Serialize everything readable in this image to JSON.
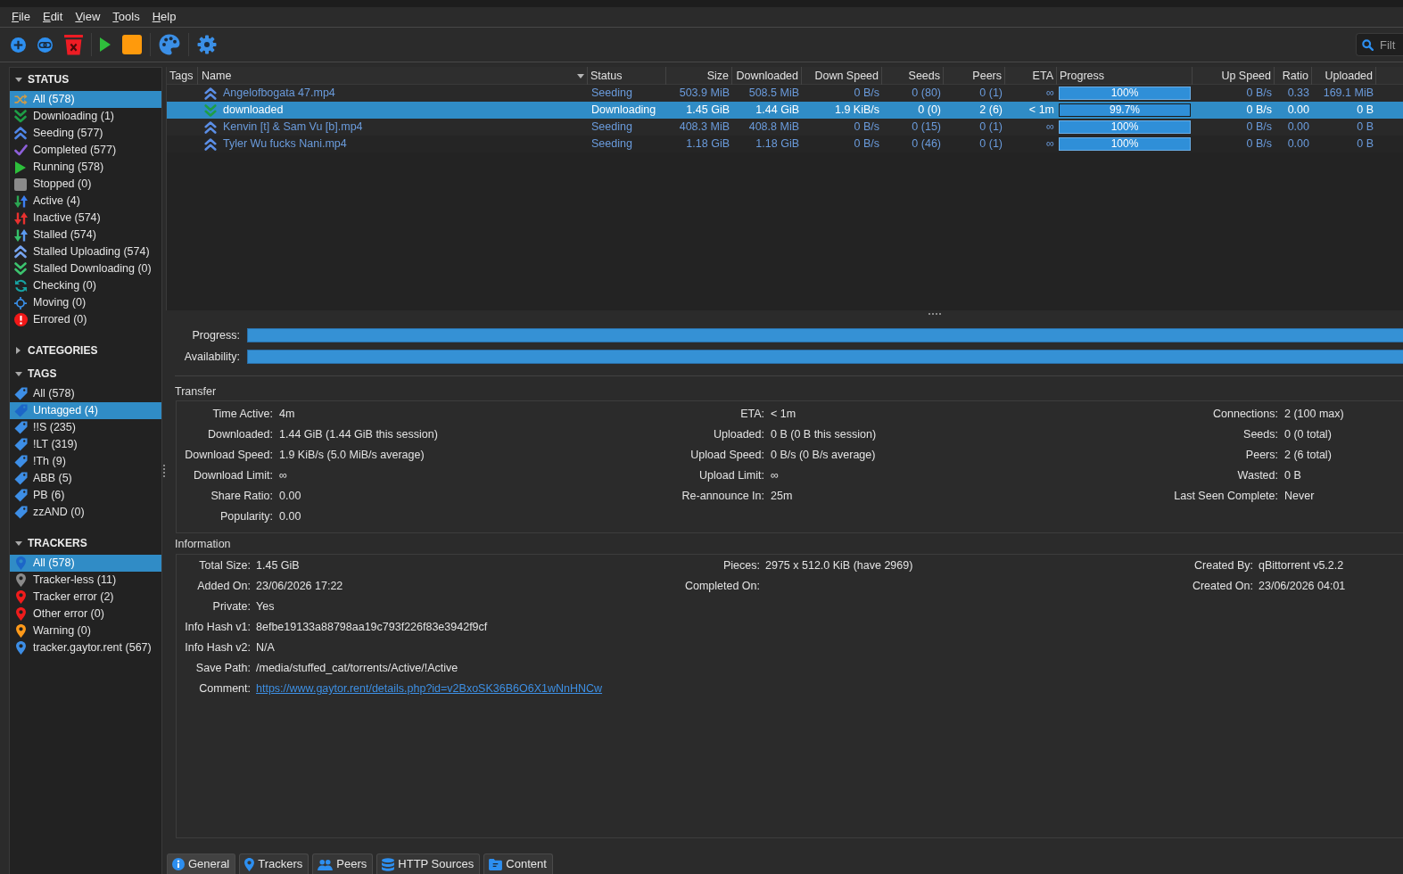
{
  "menu": [
    "File",
    "Edit",
    "View",
    "Tools",
    "Help"
  ],
  "toolbar": {
    "search": {
      "placeholder": "Filt"
    }
  },
  "sidebar": {
    "sections": [
      {
        "title": "STATUS",
        "expanded": true,
        "items": [
          {
            "label": "All (578)",
            "kind": "all",
            "selected": true
          },
          {
            "label": "Downloading (1)",
            "kind": "downloading",
            "selected": false
          },
          {
            "label": "Seeding (577)",
            "kind": "seeding",
            "selected": false
          },
          {
            "label": "Completed (577)",
            "kind": "completed",
            "selected": false
          },
          {
            "label": "Running (578)",
            "kind": "running",
            "selected": false
          },
          {
            "label": "Stopped (0)",
            "kind": "stopped",
            "selected": false
          },
          {
            "label": "Active (4)",
            "kind": "active",
            "selected": false
          },
          {
            "label": "Inactive (574)",
            "kind": "inactive",
            "selected": false
          },
          {
            "label": "Stalled (574)",
            "kind": "stalled",
            "selected": false
          },
          {
            "label": "Stalled Uploading (574)",
            "kind": "stalledup",
            "selected": false
          },
          {
            "label": "Stalled Downloading (0)",
            "kind": "stalleddown",
            "selected": false
          },
          {
            "label": "Checking (0)",
            "kind": "checking",
            "selected": false
          },
          {
            "label": "Moving (0)",
            "kind": "moving",
            "selected": false
          },
          {
            "label": "Errored (0)",
            "kind": "errored",
            "selected": false
          }
        ]
      },
      {
        "title": "CATEGORIES",
        "expanded": false
      },
      {
        "title": "TAGS",
        "expanded": true,
        "items": [
          {
            "label": "All (578)",
            "kind": "tag",
            "selected": false
          },
          {
            "label": "Untagged (4)",
            "kind": "tag",
            "selected": true
          },
          {
            "label": "!!S (235)",
            "kind": "tag",
            "selected": false
          },
          {
            "label": "!LT (319)",
            "kind": "tag",
            "selected": false
          },
          {
            "label": "!Th (9)",
            "kind": "tag",
            "selected": false
          },
          {
            "label": "ABB (5)",
            "kind": "tag",
            "selected": false
          },
          {
            "label": "PB (6)",
            "kind": "tag",
            "selected": false
          },
          {
            "label": "zzAND (0)",
            "kind": "tag",
            "selected": false
          }
        ]
      },
      {
        "title": "TRACKERS",
        "expanded": true,
        "items": [
          {
            "label": "All (578)",
            "kind": "pin",
            "color": "#1c66c8",
            "selected": true
          },
          {
            "label": "Tracker-less (11)",
            "kind": "pin",
            "color": "#8a8a8a",
            "selected": false
          },
          {
            "label": "Tracker error (2)",
            "kind": "pin",
            "color": "#f01c1c",
            "selected": false
          },
          {
            "label": "Other error (0)",
            "kind": "pin",
            "color": "#f01c1c",
            "selected": false
          },
          {
            "label": "Warning (0)",
            "kind": "pin",
            "color": "#ff9a1a",
            "selected": false
          },
          {
            "label": "tracker.gaytor.rent (567)",
            "kind": "pin",
            "color": "#3d8ee6",
            "selected": false
          }
        ]
      }
    ]
  },
  "table": {
    "columns": [
      {
        "label": "Tags",
        "sorted": false
      },
      {
        "label": "Name",
        "sorted": true
      },
      {
        "label": "Status",
        "sorted": false
      },
      {
        "label": "Size",
        "sorted": false
      },
      {
        "label": "Downloaded",
        "sorted": false
      },
      {
        "label": "Down Speed",
        "sorted": false
      },
      {
        "label": "Seeds",
        "sorted": false
      },
      {
        "label": "Peers",
        "sorted": false
      },
      {
        "label": "ETA",
        "sorted": false
      },
      {
        "label": "Progress",
        "sorted": false
      },
      {
        "label": "Up Speed",
        "sorted": false
      },
      {
        "label": "Ratio",
        "sorted": false
      },
      {
        "label": "Uploaded",
        "sorted": false
      }
    ],
    "rows": [
      {
        "kind": "seeding",
        "selected": false,
        "name": "Angelofbogata 47.mp4",
        "status": "Seeding",
        "size": "503.9 MiB",
        "downloaded": "508.5 MiB",
        "down_speed": "0 B/s",
        "seeds": "0 (80)",
        "peers": "0 (1)",
        "eta": "∞",
        "progress": {
          "level": 1,
          "text": "100%"
        },
        "up_speed": "0 B/s",
        "ratio": "0.33",
        "uploaded": "169.1 MiB"
      },
      {
        "kind": "downloading",
        "selected": true,
        "name": "downloaded",
        "status": "Downloading",
        "size": "1.45 GiB",
        "downloaded": "1.44 GiB",
        "down_speed": "1.9 KiB/s",
        "seeds": "0 (0)",
        "peers": "2 (6)",
        "eta": "< 1m",
        "progress": {
          "level": 0.997,
          "text": "99.7%"
        },
        "up_speed": "0 B/s",
        "ratio": "0.00",
        "uploaded": "0 B"
      },
      {
        "kind": "seeding",
        "selected": false,
        "name": "Kenvin [t] & Sam Vu [b].mp4",
        "status": "Seeding",
        "size": "408.3 MiB",
        "downloaded": "408.8 MiB",
        "down_speed": "0 B/s",
        "seeds": "0 (15)",
        "peers": "0 (1)",
        "eta": "∞",
        "progress": {
          "level": 1,
          "text": "100%"
        },
        "up_speed": "0 B/s",
        "ratio": "0.00",
        "uploaded": "0 B"
      },
      {
        "kind": "seeding",
        "selected": false,
        "name": "Tyler Wu fucks Nani.mp4",
        "status": "Seeding",
        "size": "1.18 GiB",
        "downloaded": "1.18 GiB",
        "down_speed": "0 B/s",
        "seeds": "0 (46)",
        "peers": "0 (1)",
        "eta": "∞",
        "progress": {
          "level": 1,
          "text": "100%"
        },
        "up_speed": "0 B/s",
        "ratio": "0.00",
        "uploaded": "0 B"
      }
    ]
  },
  "details": {
    "bars": [
      {
        "label": "Progress:",
        "level": 1
      },
      {
        "label": "Availability:",
        "level": 1
      }
    ],
    "groups": [
      {
        "title": "Transfer",
        "rows": [
          [
            {
              "label": "Time Active:",
              "value": "4m"
            },
            {
              "label": "ETA:",
              "value": "< 1m"
            },
            {
              "label": "Connections:",
              "value": "2 (100 max)"
            }
          ],
          [
            {
              "label": "Downloaded:",
              "value": "1.44 GiB (1.44 GiB this session)"
            },
            {
              "label": "Uploaded:",
              "value": "0 B (0 B this session)"
            },
            {
              "label": "Seeds:",
              "value": "0 (0 total)"
            }
          ],
          [
            {
              "label": "Download Speed:",
              "value": "1.9 KiB/s (5.0 MiB/s average)"
            },
            {
              "label": "Upload Speed:",
              "value": "0 B/s (0 B/s average)"
            },
            {
              "label": "Peers:",
              "value": "2 (6 total)"
            }
          ],
          [
            {
              "label": "Download Limit:",
              "value": "∞"
            },
            {
              "label": "Upload Limit:",
              "value": "∞"
            },
            {
              "label": "Wasted:",
              "value": "0 B"
            }
          ],
          [
            {
              "label": "Share Ratio:",
              "value": "0.00"
            },
            {
              "label": "Re-announce In:",
              "value": "25m"
            },
            {
              "label": "Last Seen Complete:",
              "value": "Never"
            }
          ],
          [
            {
              "label": "Popularity:",
              "value": "0.00"
            }
          ]
        ]
      },
      {
        "title": "Information",
        "rows": [
          [
            {
              "label": "Total Size:",
              "value": "1.45 GiB"
            },
            {
              "label": "Pieces:",
              "value": "2975 x 512.0 KiB (have 2969)"
            },
            {
              "label": "Created By:",
              "value": "qBittorrent v5.2.2"
            }
          ],
          [
            {
              "label": "Added On:",
              "value": "23/06/2026 17:22"
            },
            {
              "label": "Completed On:"
            },
            {
              "label": "Created On:",
              "value": "23/06/2026 04:01"
            }
          ],
          [
            {
              "label": "Private:",
              "value": "Yes"
            }
          ],
          [
            {
              "label": "Info Hash v1:",
              "value": "8efbe19133a88798aa19c793f226f83e3942f9cf"
            }
          ],
          [
            {
              "label": "Info Hash v2:",
              "value": "N/A"
            }
          ],
          [
            {
              "label": "Save Path:",
              "value": "/media/stuffed_cat/torrents/Active/!Active"
            }
          ]
        ],
        "comment": {
          "label": "Comment:",
          "link": "https://www.gaytor.rent/details.php?id=v2BxoSK36B6O6X1wNnHNCw"
        }
      }
    ]
  },
  "tabs": [
    {
      "label": "General",
      "kind": "info",
      "selected": true
    },
    {
      "label": "Trackers",
      "kind": "trackers",
      "selected": false
    },
    {
      "label": "Peers",
      "kind": "peers",
      "selected": false
    },
    {
      "label": "HTTP Sources",
      "kind": "sources",
      "selected": false
    },
    {
      "label": "Content",
      "kind": "content",
      "selected": false
    }
  ]
}
